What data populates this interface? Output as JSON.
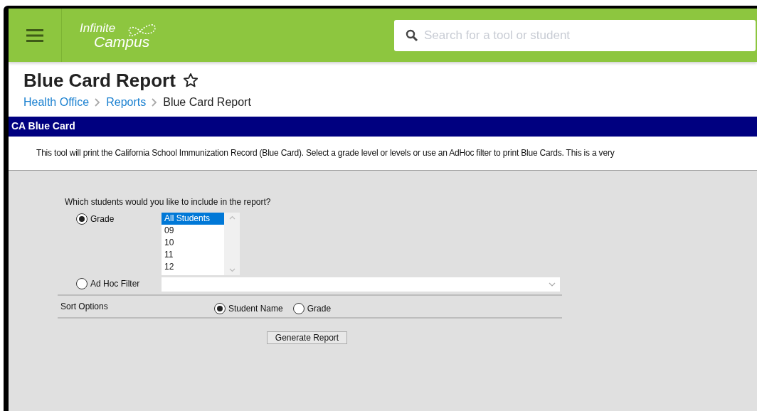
{
  "header": {
    "logo": [
      "Infinite",
      "Campus"
    ],
    "search": {
      "placeholder": "Search for a tool or student"
    }
  },
  "page": {
    "title": "Blue Card Report",
    "favorite": false,
    "breadcrumbs": [
      {
        "label": "Health Office",
        "link": true
      },
      {
        "label": "Reports",
        "link": true
      },
      {
        "label": "Blue Card Report",
        "link": false
      }
    ]
  },
  "section": {
    "title": "CA Blue Card",
    "description": "This tool will print the California School Immunization Record (Blue Card). Select a grade level or levels or use an AdHoc filter to print Blue Cards. This is a very"
  },
  "form": {
    "question": "Which students would you like to include in the report?",
    "grade_option": {
      "label": "Grade",
      "selected": true
    },
    "grades": [
      {
        "label": "All Students",
        "selected": true
      },
      {
        "label": "09",
        "selected": false
      },
      {
        "label": "10",
        "selected": false
      },
      {
        "label": "11",
        "selected": false
      },
      {
        "label": "12",
        "selected": false
      }
    ],
    "adhoc_option": {
      "label": "Ad Hoc Filter",
      "selected": false
    },
    "sort_label": "Sort Options",
    "sort_options": [
      {
        "label": "Student Name",
        "selected": true
      },
      {
        "label": "Grade",
        "selected": false
      }
    ],
    "button": "Generate Report"
  }
}
